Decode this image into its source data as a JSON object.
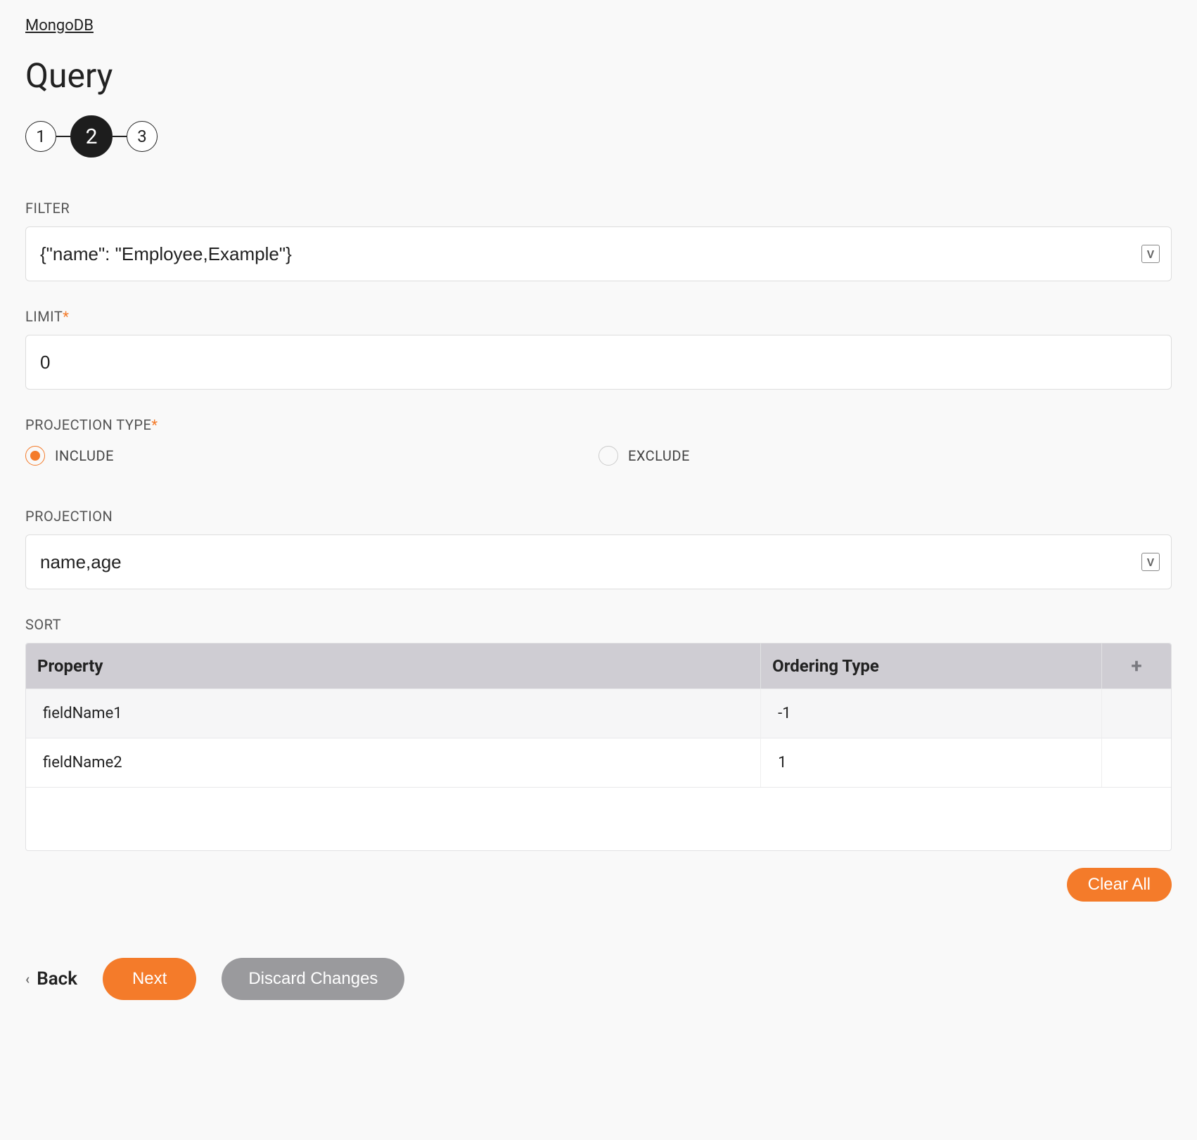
{
  "breadcrumb": "MongoDB",
  "page_title": "Query",
  "stepper": {
    "steps": [
      "1",
      "2",
      "3"
    ],
    "active_index": 1
  },
  "filter": {
    "label": "FILTER",
    "value": "{\"name\": \"Employee,Example\"}",
    "badge": "V"
  },
  "limit": {
    "label": "LIMIT",
    "value": "0",
    "required": true
  },
  "projection_type": {
    "label": "PROJECTION TYPE",
    "required": true,
    "options": [
      "INCLUDE",
      "EXCLUDE"
    ],
    "selected": "INCLUDE"
  },
  "projection": {
    "label": "PROJECTION",
    "value": "name,age",
    "badge": "V"
  },
  "sort": {
    "label": "SORT",
    "columns": [
      "Property",
      "Ordering Type"
    ],
    "rows": [
      {
        "property": "fieldName1",
        "ordering": "-1"
      },
      {
        "property": "fieldName2",
        "ordering": "1"
      }
    ]
  },
  "buttons": {
    "clear_all": "Clear All",
    "back": "Back",
    "next": "Next",
    "discard": "Discard Changes"
  }
}
